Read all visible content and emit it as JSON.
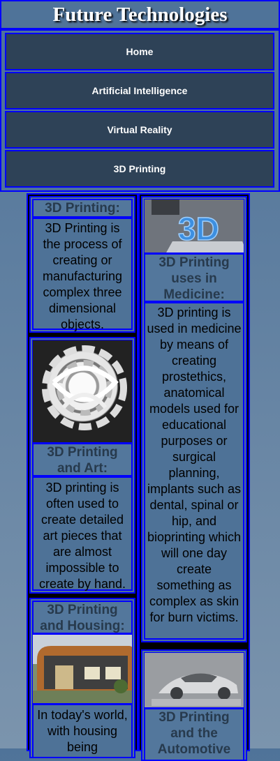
{
  "site": {
    "title": "Future Technologies"
  },
  "nav": {
    "items": [
      {
        "label": "Home"
      },
      {
        "label": "Artificial Intelligence"
      },
      {
        "label": "Virtual Reality"
      },
      {
        "label": "3D Printing"
      }
    ]
  },
  "cards": {
    "printing": {
      "title": "3D Printing:",
      "text": "3D Printing is the process of creating or manufacturing complex three dimensional objects."
    },
    "art": {
      "title": "3D Printing and Art:",
      "text": "3D printing is often used to create detailed art pieces that are almost impossible to create by hand."
    },
    "housing": {
      "title": "3D Printing and Housing:",
      "text": "In today's world, with housing being"
    },
    "medicine": {
      "title": "3D Printing uses in Medicine:",
      "text": "3D printing is used in medicine by means of creating prostethics, anatomical models used for educational purposes or surgical planning, implants such as dental, spinal or hip, and bioprinting which will one day create something as complex as skin for burn victims."
    },
    "automotive": {
      "title": "3D Printing and the Automotive"
    }
  },
  "images": {
    "medicine": "3d-printer-printing-blue-3d-letters",
    "art": "white-lattice-sphere-sculpture",
    "housing": "3d-printed-curved-tiny-house",
    "automotive": "3d-printed-car-model"
  }
}
